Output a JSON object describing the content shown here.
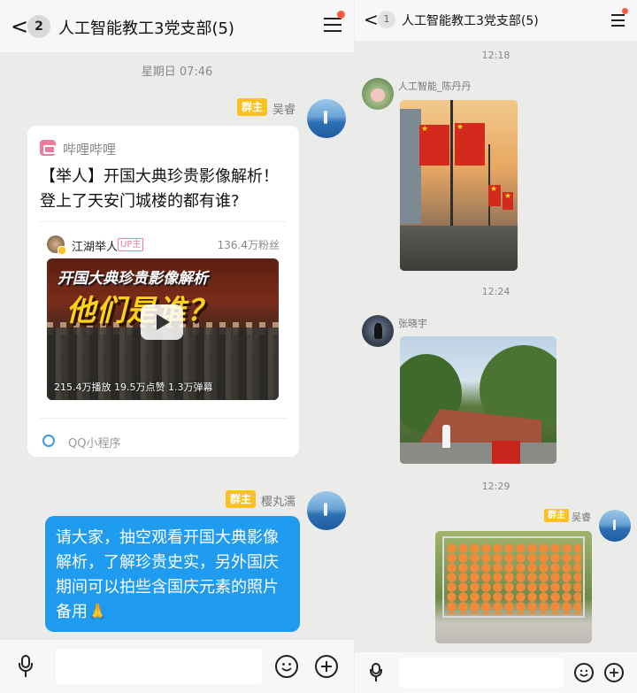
{
  "left": {
    "header": {
      "back_glyph": "<",
      "unread_badge": "2",
      "title": "人工智能教工3党支部(5)"
    },
    "timestamp": "星期日 07:46",
    "message1": {
      "role": "群主",
      "sender": "吴睿",
      "card": {
        "app_name": "哔哩哔哩",
        "headline": "【举人】开国大典珍贵影像解析！登上了天安门城楼的都有谁?",
        "uploader": "江湖举人",
        "uploader_tag": "UP主",
        "fans": "136.4万粉丝",
        "thumb_banner_top": "开国大典珍贵影像解析",
        "thumb_banner_big": "他们是谁？",
        "stats": "215.4万播放  19.5万点赞  1.3万弹幕",
        "mini_program": "QQ小程序"
      }
    },
    "message2": {
      "role": "群主",
      "sender": "樱丸濡",
      "text": "请大家，抽空观看开国大典影像解析，了解珍贵史实，另外国庆期间可以拍些含国庆元素的照片备用🙏"
    }
  },
  "right": {
    "header": {
      "back_glyph": "<",
      "unread_badge": "1",
      "title": "人工智能教工3党支部(5)"
    },
    "messages": [
      {
        "time": "12:18",
        "sender": "人工智能_陈丹丹",
        "type": "image",
        "image": "flags-street-photo"
      },
      {
        "time": "12:24",
        "sender": "张晓宇",
        "type": "image",
        "image": "garden-memorial-photo"
      },
      {
        "time": "12:29",
        "role": "群主",
        "sender": "吴睿",
        "type": "image",
        "image": "lantern-wall-photo"
      }
    ]
  },
  "colors": {
    "bubble_blue": "#1f9bf0",
    "owner_tag": "#fbc21f",
    "notify_dot": "#ff5a3c",
    "bili_pink": "#ee7a9d"
  }
}
